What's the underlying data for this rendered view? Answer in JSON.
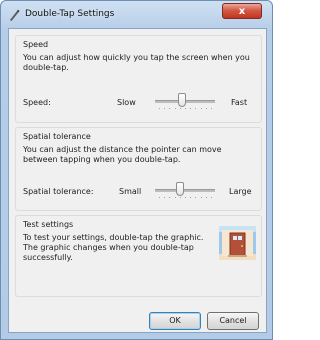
{
  "window": {
    "title": "Double-Tap Settings",
    "close_symbol": "x"
  },
  "speed": {
    "group_title": "Speed",
    "description": "You can adjust how quickly you tap the screen when you double-tap.",
    "label": "Speed:",
    "min_label": "Slow",
    "max_label": "Fast",
    "slider_value": 0.45
  },
  "spatial": {
    "group_title": "Spatial tolerance",
    "description": "You can adjust the distance the pointer can move between tapping when you double-tap.",
    "label": "Spatial tolerance:",
    "min_label": "Small",
    "max_label": "Large",
    "slider_value": 0.4
  },
  "test": {
    "group_title": "Test settings",
    "description": "To test your settings, double-tap the graphic. The graphic changes when you double-tap successfully.",
    "graphic": "door-icon"
  },
  "buttons": {
    "ok": "OK",
    "cancel": "Cancel"
  }
}
